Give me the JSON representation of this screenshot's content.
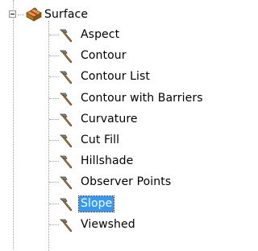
{
  "tree": {
    "root": {
      "label": "Surface",
      "expanded": true,
      "icon": "toolbox-icon"
    },
    "items": [
      {
        "label": "Aspect",
        "icon": "hammer-tool-icon",
        "selected": false
      },
      {
        "label": "Contour",
        "icon": "hammer-tool-icon",
        "selected": false
      },
      {
        "label": "Contour List",
        "icon": "hammer-tool-icon",
        "selected": false
      },
      {
        "label": "Contour with Barriers",
        "icon": "hammer-tool-icon",
        "selected": false
      },
      {
        "label": "Curvature",
        "icon": "hammer-tool-icon",
        "selected": false
      },
      {
        "label": "Cut Fill",
        "icon": "hammer-tool-icon",
        "selected": false
      },
      {
        "label": "Hillshade",
        "icon": "hammer-tool-icon",
        "selected": false
      },
      {
        "label": "Observer Points",
        "icon": "hammer-tool-icon",
        "selected": false
      },
      {
        "label": "Slope",
        "icon": "hammer-tool-icon",
        "selected": true
      },
      {
        "label": "Viewshed",
        "icon": "hammer-tool-icon",
        "selected": false
      }
    ]
  },
  "colors": {
    "selection": "#3399ff",
    "tree_lines": "#a0a0a0"
  }
}
